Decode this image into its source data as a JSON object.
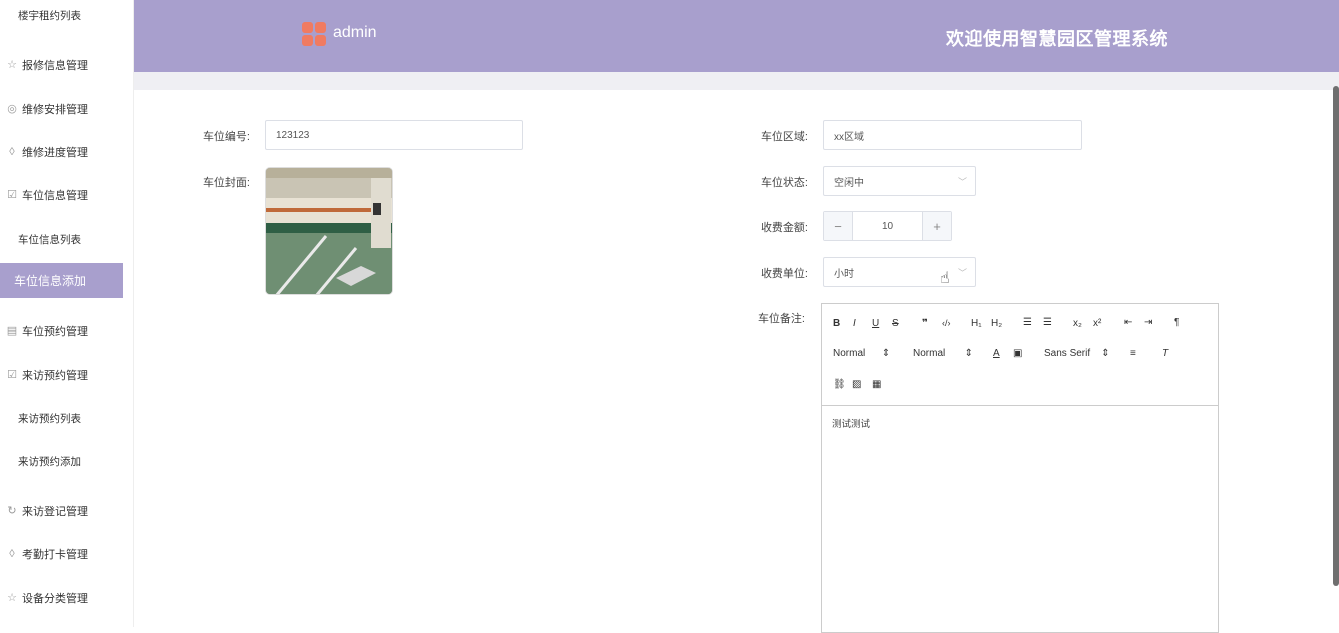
{
  "sidebar": {
    "top_item": "楼宇租约列表",
    "items": [
      {
        "label": "报修信息管理",
        "icon": "star-icon"
      },
      {
        "label": "维修安排管理",
        "icon": "compass-icon"
      },
      {
        "label": "维修进度管理",
        "icon": "drop-icon"
      },
      {
        "label": "车位信息管理",
        "icon": "checkbox-icon"
      }
    ],
    "sub1": "车位信息列表",
    "active": "车位信息添加",
    "items2": [
      {
        "label": "车位预约管理",
        "icon": "archive-icon"
      },
      {
        "label": "来访预约管理",
        "icon": "checkbox-icon"
      }
    ],
    "sub2": [
      "来访预约列表",
      "来访预约添加"
    ],
    "items3": [
      {
        "label": "来访登记管理",
        "icon": "refresh-icon"
      },
      {
        "label": "考勤打卡管理",
        "icon": "drop-icon"
      },
      {
        "label": "设备分类管理",
        "icon": "star-icon"
      }
    ]
  },
  "header": {
    "admin": "admin",
    "welcome": "欢迎使用智慧园区管理系统",
    "color": "#a89fcd"
  },
  "form": {
    "number_label": "车位编号:",
    "number_value": "123123",
    "cover_label": "车位封面:",
    "area_label": "车位区域:",
    "area_value": "xx区域",
    "status_label": "车位状态:",
    "status_value": "空闲中",
    "fee_label": "收费金额:",
    "fee_value": "10",
    "unit_label": "收费单位:",
    "unit_value": "小时",
    "remark_label": "车位备注:",
    "remark_value": "测试测试"
  },
  "editor": {
    "header_select": "Normal",
    "size_select": "Normal",
    "font_select": "Sans Serif"
  }
}
